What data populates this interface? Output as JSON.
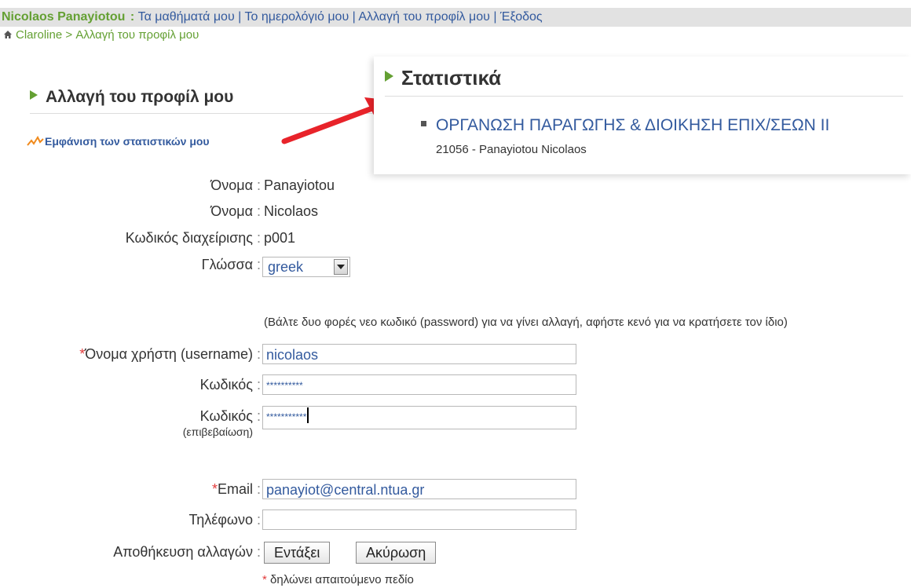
{
  "topbar": {
    "user": "Nicolaos Panayiotou",
    "colon": " : ",
    "links": [
      "Τα μαθήματά μου",
      "Το ημερολόγιό μου",
      "Αλλαγή του προφίλ μου",
      "Έξοδος"
    ],
    "separator": " | "
  },
  "breadcrumb": {
    "home": "Claroline",
    "separator": " > ",
    "current": "Αλλαγή του προφίλ μου"
  },
  "page": {
    "title": "Αλλαγή του προφίλ μου",
    "stats_link": "Εμφάνιση των στατιστικών μου"
  },
  "popup": {
    "title": "Στατιστικά",
    "course": "ΟΡΓΑΝΩΣΗ ΠΑΡΑΓΩΓΗΣ & ΔΙΟΙΚΗΣΗ ΕΠΙΧ/ΣΕΩΝ ΙΙ",
    "course_sub": "21056 - Panayiotou Nicolaos"
  },
  "form": {
    "colon": " : ",
    "lastname_label": "Όνομα",
    "lastname_value": "Panayiotou",
    "firstname_label": "Όνομα",
    "firstname_value": "Nicolaos",
    "admin_code_label": "Κωδικός διαχείρισης",
    "admin_code_value": "p001",
    "language_label": "Γλώσσα",
    "language_value": "greek",
    "password_hint": "(Βάλτε δυο φορές νεο κωδικό (password) για να γίνει αλλαγή, αφήστε κενό για να κρατήσετε τον ίδιο)",
    "required_mark": "*",
    "username_label": "Όνομα χρήστη (username)",
    "username_value": "nicolaos",
    "password_label": "Κωδικός",
    "password_value": "**********",
    "password_confirm_label": "Κωδικός",
    "password_confirm_sub": "(επιβεβαίωση)",
    "password_confirm_value": "***********",
    "email_label": "Email",
    "email_value": "panayiot@central.ntua.gr",
    "phone_label": "Τηλέφωνο",
    "phone_value": "",
    "save_label": "Αποθήκευση αλλαγών",
    "ok_button": "Εντάξει",
    "cancel_button": "Ακύρωση",
    "footnote": "δηλώνει απαιτούμενο πεδίο"
  },
  "colors": {
    "accent_green": "#64a033",
    "link_blue": "#335a9e",
    "required_red": "#e23b3b",
    "arrow_red": "#e8232a"
  }
}
